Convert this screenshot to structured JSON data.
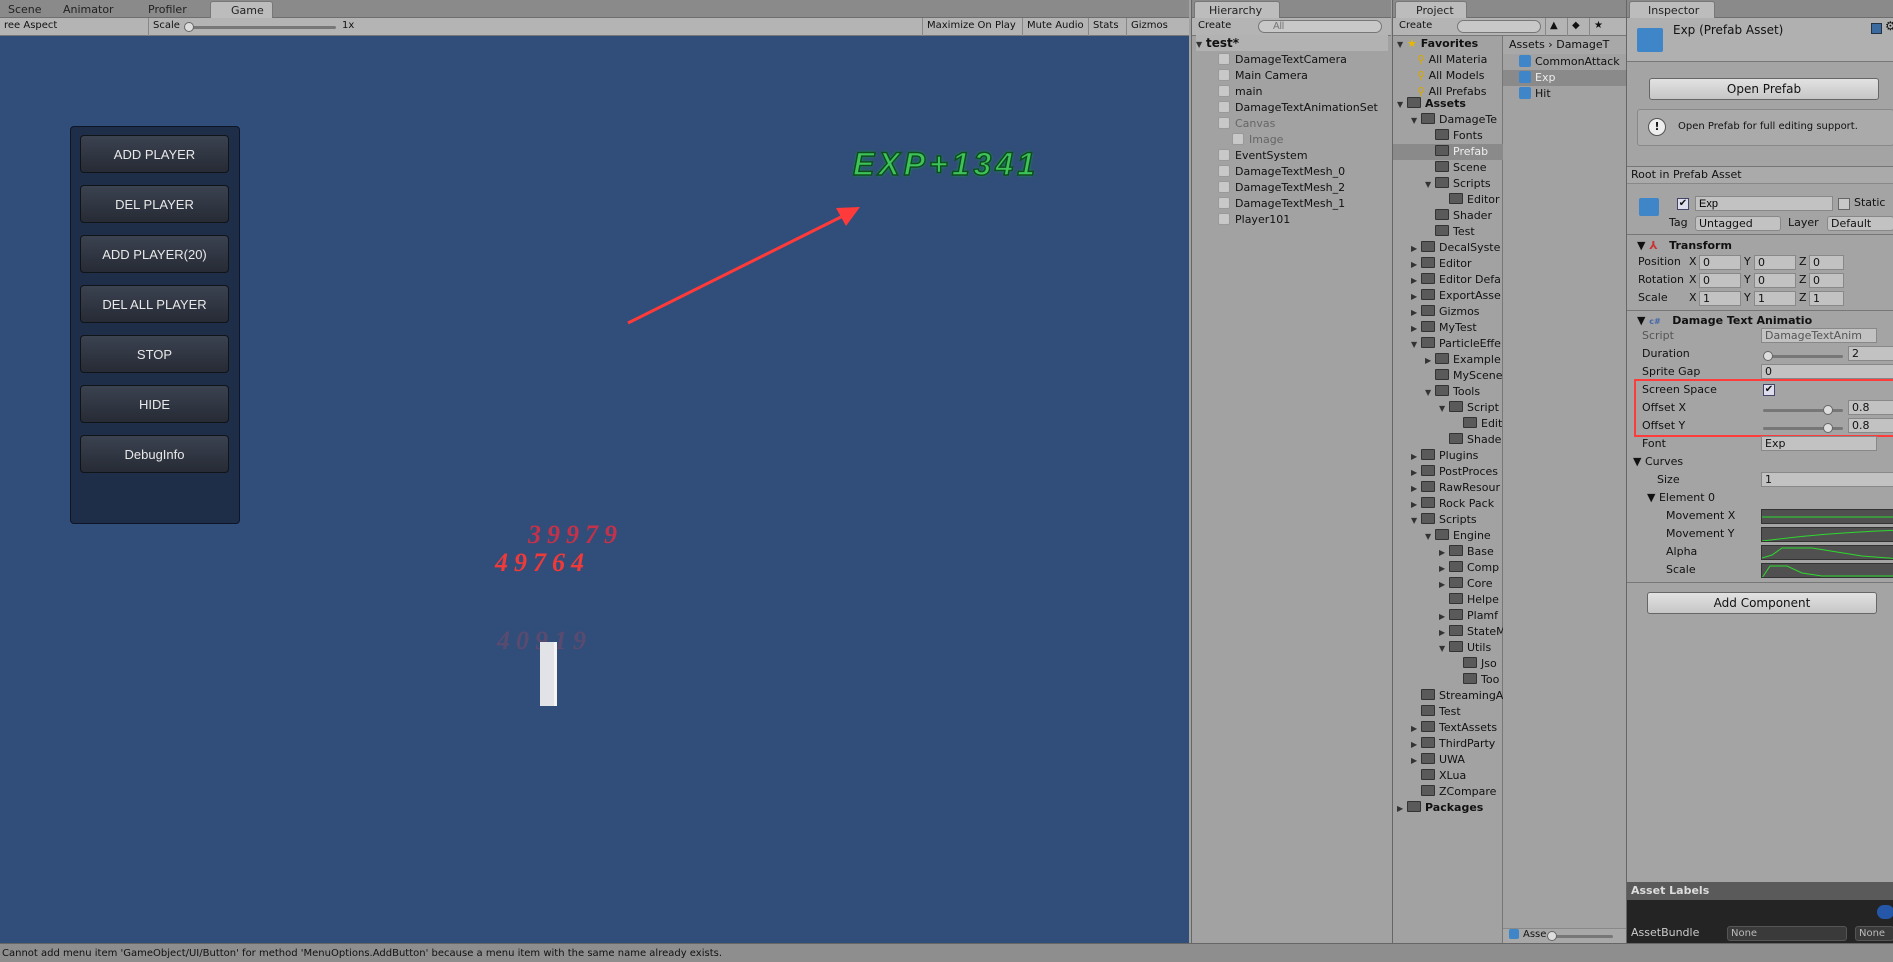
{
  "game_tabs": [
    "Scene",
    "Animator",
    "Profiler",
    "Game"
  ],
  "game_toolbar": {
    "aspect": "ree Aspect",
    "scale_label": "Scale",
    "scale_value": "1x",
    "maximize": "Maximize On Play",
    "mute": "Mute Audio",
    "stats": "Stats",
    "gizmos": "Gizmos"
  },
  "game_buttons": [
    "ADD PLAYER",
    "DEL PLAYER",
    "ADD PLAYER(20)",
    "DEL ALL PLAYER",
    "STOP",
    "HIDE",
    "DebugInfo"
  ],
  "game_texts": {
    "exp": "EXP+1341",
    "dmg1": "39979",
    "dmg2": "49764",
    "dmg3": "40919"
  },
  "hierarchy": {
    "title": "Hierarchy",
    "create": "Create",
    "search_placeholder": "All",
    "scene": "test*",
    "items": [
      {
        "label": "DamageTextCamera",
        "depth": 0
      },
      {
        "label": "Main Camera",
        "depth": 0
      },
      {
        "label": "main",
        "depth": 0
      },
      {
        "label": "DamageTextAnimationSet",
        "depth": 0
      },
      {
        "label": "Canvas",
        "depth": 0,
        "expanded": true,
        "disabled": true
      },
      {
        "label": "Image",
        "depth": 1,
        "disabled": true
      },
      {
        "label": "EventSystem",
        "depth": 0
      },
      {
        "label": "DamageTextMesh_0",
        "depth": 0
      },
      {
        "label": "DamageTextMesh_2",
        "depth": 0
      },
      {
        "label": "DamageTextMesh_1",
        "depth": 0
      },
      {
        "label": "Player101",
        "depth": 0
      }
    ]
  },
  "project": {
    "title": "Project",
    "create": "Create",
    "breadcrumb": [
      "Assets",
      "DamageT"
    ],
    "favorites_label": "Favorites",
    "favorites": [
      "All Materia",
      "All Models",
      "All Prefabs"
    ],
    "tree": [
      {
        "l": "Assets",
        "d": 0,
        "a": "v",
        "b": true
      },
      {
        "l": "DamageTe",
        "d": 1,
        "a": "v"
      },
      {
        "l": "Fonts",
        "d": 2
      },
      {
        "l": "Prefab",
        "d": 2,
        "sel": true
      },
      {
        "l": "Scene",
        "d": 2
      },
      {
        "l": "Scripts",
        "d": 2,
        "a": "v"
      },
      {
        "l": "Editor",
        "d": 3
      },
      {
        "l": "Shader",
        "d": 2
      },
      {
        "l": "Test",
        "d": 2
      },
      {
        "l": "DecalSyste",
        "d": 1,
        "a": ">"
      },
      {
        "l": "Editor",
        "d": 1,
        "a": ">"
      },
      {
        "l": "Editor Defa",
        "d": 1,
        "a": ">"
      },
      {
        "l": "ExportAsse",
        "d": 1,
        "a": ">"
      },
      {
        "l": "Gizmos",
        "d": 1,
        "a": ">"
      },
      {
        "l": "MyTest",
        "d": 1,
        "a": ">"
      },
      {
        "l": "ParticleEffe",
        "d": 1,
        "a": "v"
      },
      {
        "l": "Example",
        "d": 2,
        "a": ">"
      },
      {
        "l": "MyScene",
        "d": 2
      },
      {
        "l": "Tools",
        "d": 2,
        "a": "v"
      },
      {
        "l": "Script",
        "d": 3,
        "a": "v"
      },
      {
        "l": "Edit",
        "d": 4
      },
      {
        "l": "Shade",
        "d": 3
      },
      {
        "l": "Plugins",
        "d": 1,
        "a": ">"
      },
      {
        "l": "PostProces",
        "d": 1,
        "a": ">"
      },
      {
        "l": "RawResour",
        "d": 1,
        "a": ">"
      },
      {
        "l": "Rock Pack",
        "d": 1,
        "a": ">"
      },
      {
        "l": "Scripts",
        "d": 1,
        "a": "v"
      },
      {
        "l": "Engine",
        "d": 2,
        "a": "v"
      },
      {
        "l": "Base",
        "d": 3,
        "a": ">"
      },
      {
        "l": "Comp",
        "d": 3,
        "a": ">"
      },
      {
        "l": "Core",
        "d": 3,
        "a": ">"
      },
      {
        "l": "Helpe",
        "d": 3
      },
      {
        "l": "Plamf",
        "d": 3,
        "a": ">"
      },
      {
        "l": "StateM",
        "d": 3,
        "a": ">"
      },
      {
        "l": "Utils",
        "d": 3,
        "a": "v"
      },
      {
        "l": "Jso",
        "d": 4
      },
      {
        "l": "Too",
        "d": 4
      },
      {
        "l": "StreamingA",
        "d": 1
      },
      {
        "l": "Test",
        "d": 1
      },
      {
        "l": "TextAssets",
        "d": 1,
        "a": ">"
      },
      {
        "l": "ThirdParty",
        "d": 1,
        "a": ">"
      },
      {
        "l": "UWA",
        "d": 1,
        "a": ">"
      },
      {
        "l": "XLua",
        "d": 1
      },
      {
        "l": "ZCompare",
        "d": 1
      },
      {
        "l": "Packages",
        "d": 0,
        "a": ">",
        "b": true
      }
    ],
    "files": [
      "CommonAttack",
      "Exp",
      "Hit"
    ],
    "selected_file": "Exp",
    "footer": "Asse"
  },
  "inspector": {
    "title": "Inspector",
    "asset_title": "Exp (Prefab Asset)",
    "open_prefab": "Open Prefab",
    "help": "Open Prefab for full editing support.",
    "root_label": "Root in Prefab Asset",
    "name": "Exp",
    "static": "Static",
    "tag_label": "Tag",
    "tag": "Untagged",
    "layer_label": "Layer",
    "layer": "Default",
    "transform": {
      "title": "Transform",
      "rows": [
        {
          "label": "Position",
          "x": "0",
          "y": "0",
          "z": "0"
        },
        {
          "label": "Rotation",
          "x": "0",
          "y": "0",
          "z": "0"
        },
        {
          "label": "Scale",
          "x": "1",
          "y": "1",
          "z": "1"
        }
      ]
    },
    "component": {
      "title": "Damage Text Animatio",
      "script_label": "Script",
      "script": "DamageTextAnim",
      "duration_label": "Duration",
      "duration": "2",
      "sprite_gap_label": "Sprite Gap",
      "sprite_gap": "0",
      "screen_space_label": "Screen Space",
      "screen_space": true,
      "offset_x_label": "Offset X",
      "offset_x": "0.8",
      "offset_y_label": "Offset Y",
      "offset_y": "0.8",
      "font_label": "Font",
      "font": "Exp",
      "curves_label": "Curves",
      "size_label": "Size",
      "size": "1",
      "element_label": "Element 0",
      "curve_labels": [
        "Movement X",
        "Movement Y",
        "Alpha",
        "Scale"
      ]
    },
    "add_component": "Add Component",
    "asset_labels": "Asset Labels",
    "assetbundle_label": "AssetBundle",
    "assetbundle": "None",
    "variant": "None"
  },
  "status": "Cannot add menu item 'GameObject/UI/Button' for method 'MenuOptions.AddButton' because a menu item with the same name already exists.",
  "colors": {
    "game_bg": "#314d79",
    "exp_text": "#2fb34a",
    "damage_text": "#e8323c",
    "highlight_box": "#ff3b3b"
  }
}
